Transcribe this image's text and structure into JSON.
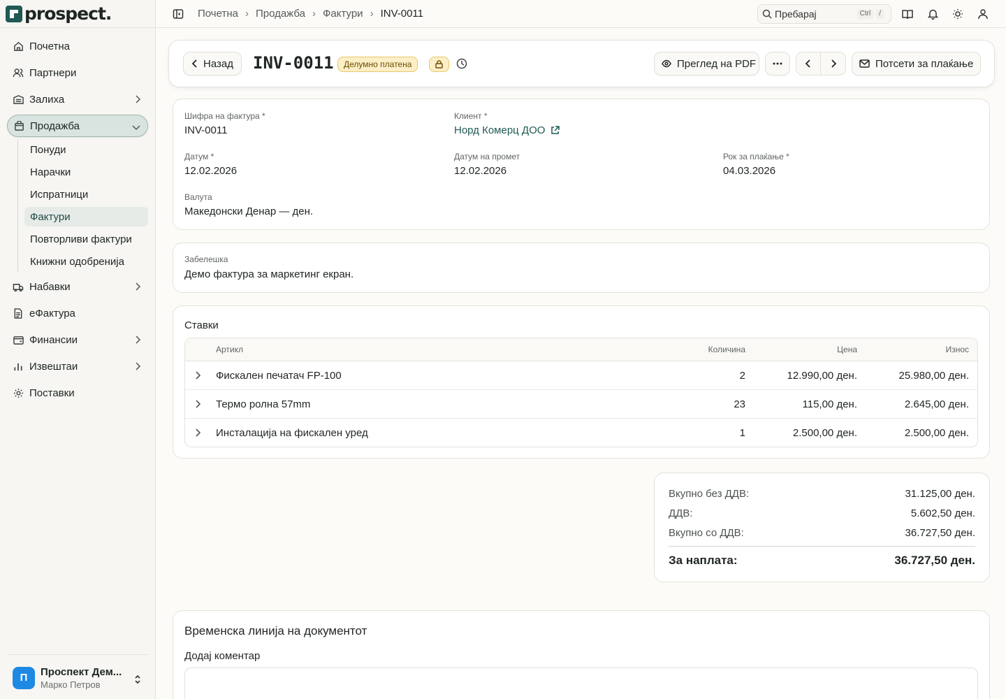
{
  "brand": {
    "name": "prospect.",
    "color": "#1f5a55"
  },
  "sidebar": {
    "items": [
      {
        "label": "Почетна",
        "icon": "home-icon"
      },
      {
        "label": "Партнери",
        "icon": "users-icon"
      },
      {
        "label": "Залиха",
        "icon": "warehouse-icon"
      },
      {
        "label": "Продажба",
        "icon": "shopping-bag-icon"
      },
      {
        "label": "Набавки",
        "icon": "truck-icon"
      },
      {
        "label": "еФактура",
        "icon": "document-icon"
      },
      {
        "label": "Финансии",
        "icon": "wallet-icon"
      },
      {
        "label": "Извештаи",
        "icon": "bar-chart-icon"
      },
      {
        "label": "Поставки",
        "icon": "gear-icon"
      }
    ],
    "sales_sub": [
      "Понуди",
      "Нарачки",
      "Испратници",
      "Фактури",
      "Повторливи фактури",
      "Книжни одобренија"
    ],
    "user": {
      "initial": "П",
      "name": "Проспект Дем...",
      "person": "Марко Петров"
    }
  },
  "topbar": {
    "breadcrumbs": [
      "Почетна",
      "Продажба",
      "Фактури",
      "INV-0011"
    ],
    "search_placeholder": "Пребарај",
    "shortcut": [
      "Ctrl",
      "/"
    ]
  },
  "header": {
    "back_label": "Назад",
    "title": "INV-0011",
    "status": "Делумно платена",
    "pdf_label": "Преглед на PDF",
    "remind_label": "Потсети за плаќање"
  },
  "details": {
    "code_label": "Шифра на фактура *",
    "code_value": "INV-0011",
    "client_label": "Клиент *",
    "client_value": "Норд Комерц ДОО",
    "date_label": "Датум *",
    "date_value": "12.02.2026",
    "trade_date_label": "Датум на промет",
    "trade_date_value": "12.02.2026",
    "due_label": "Рок за плаќање *",
    "due_value": "04.03.2026",
    "currency_label": "Валута",
    "currency_value": "Македонски Денар — ден."
  },
  "note": {
    "label": "Забелешка",
    "value": "Демо фактура за маркетинг екран."
  },
  "items": {
    "title": "Ставки",
    "columns": [
      "Артикл",
      "Количина",
      "Цена",
      "Износ"
    ],
    "rows": [
      {
        "name": "Фискален печатач FP-100",
        "qty": "2",
        "price": "12.990,00 ден.",
        "total": "25.980,00 ден."
      },
      {
        "name": "Термо ролна 57mm",
        "qty": "23",
        "price": "115,00 ден.",
        "total": "2.645,00 ден."
      },
      {
        "name": "Инсталација на фискален уред",
        "qty": "1",
        "price": "2.500,00 ден.",
        "total": "2.500,00 ден."
      }
    ]
  },
  "totals": {
    "subtotal_label": "Вкупно без ДДВ:",
    "subtotal": "31.125,00 ден.",
    "vat_label": "ДДВ:",
    "vat": "5.602,50 ден.",
    "total_label": "Вкупно со ДДВ:",
    "total": "36.727,50 ден.",
    "due_label": "За наплата:",
    "due": "36.727,50 ден."
  },
  "timeline": {
    "title": "Временска линија на документот",
    "comment_label": "Додај коментар"
  },
  "colors": {
    "accent": "#1f5a55",
    "badge_bg": "#fcefc7",
    "badge_border": "#e7c86a",
    "avatar": "#1e88e5"
  }
}
